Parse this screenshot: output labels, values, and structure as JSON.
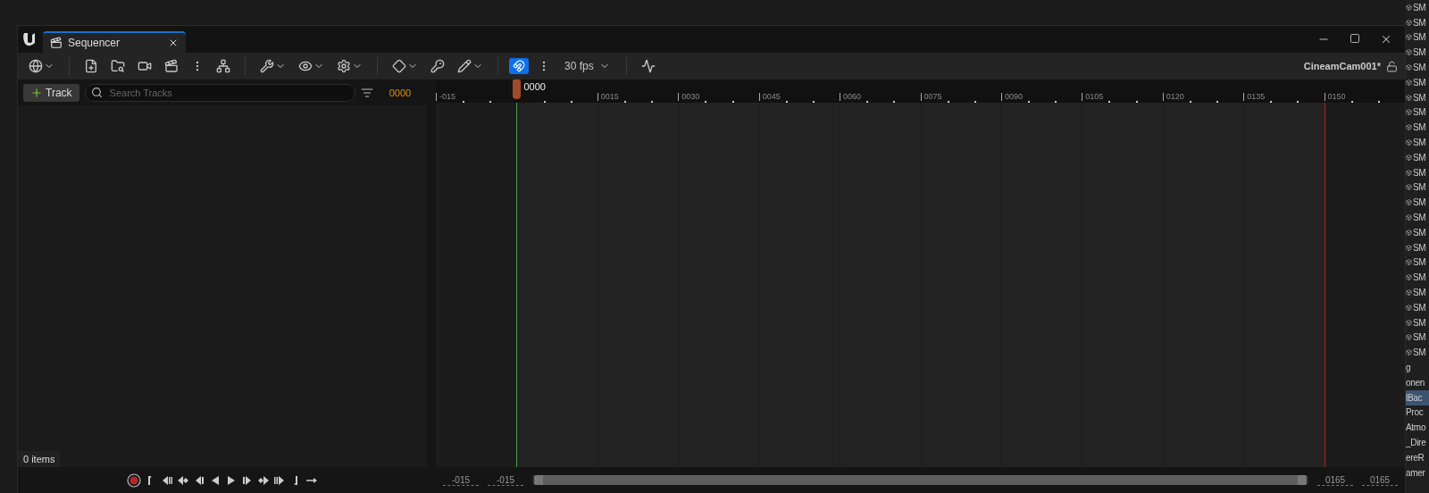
{
  "window": {
    "tab": {
      "label": "Sequencer",
      "selected": true
    }
  },
  "toolbar": {
    "snap": {
      "on": true
    },
    "frame_rate": "30 fps",
    "sequence_name": "CineamCam001*"
  },
  "tracks": {
    "add_button": "Track",
    "search": {
      "placeholder": "Search Tracks"
    },
    "current_frame": "0000",
    "status": "0 items"
  },
  "timeline": {
    "playhead": "0000",
    "ticks": [
      "-015",
      "0015",
      "0030",
      "0045",
      "0060",
      "0075",
      "0090",
      "0105",
      "0120",
      "0135",
      "0150"
    ]
  },
  "range": {
    "view_start": "-015",
    "work_start": "-015",
    "work_end": "0165",
    "view_end": "0165"
  },
  "outliner": {
    "items": [
      {
        "text": "SM",
        "kind": "mesh",
        "selected": false
      },
      {
        "text": "SM",
        "kind": "mesh",
        "selected": false
      },
      {
        "text": "SM",
        "kind": "mesh",
        "selected": false
      },
      {
        "text": "SM",
        "kind": "mesh",
        "selected": false
      },
      {
        "text": "SM",
        "kind": "mesh",
        "selected": false
      },
      {
        "text": "SM",
        "kind": "mesh",
        "selected": false
      },
      {
        "text": "SM",
        "kind": "mesh",
        "selected": false
      },
      {
        "text": "SM",
        "kind": "mesh",
        "selected": false
      },
      {
        "text": "SM",
        "kind": "mesh",
        "selected": false
      },
      {
        "text": "SM",
        "kind": "mesh",
        "selected": false
      },
      {
        "text": "SM",
        "kind": "mesh",
        "selected": false
      },
      {
        "text": "SM",
        "kind": "mesh",
        "selected": false
      },
      {
        "text": "SM",
        "kind": "mesh",
        "selected": false
      },
      {
        "text": "SM",
        "kind": "mesh",
        "selected": false
      },
      {
        "text": "SM",
        "kind": "mesh",
        "selected": false
      },
      {
        "text": "SM",
        "kind": "mesh",
        "selected": false
      },
      {
        "text": "SM",
        "kind": "mesh",
        "selected": false
      },
      {
        "text": "SM",
        "kind": "mesh",
        "selected": false
      },
      {
        "text": "SM",
        "kind": "mesh",
        "selected": false
      },
      {
        "text": "SM",
        "kind": "mesh",
        "selected": false
      },
      {
        "text": "SM",
        "kind": "mesh",
        "selected": false
      },
      {
        "text": "SM",
        "kind": "mesh",
        "selected": false
      },
      {
        "text": "SM",
        "kind": "mesh",
        "selected": false
      },
      {
        "text": "SM",
        "kind": "mesh",
        "selected": false
      },
      {
        "text": "g",
        "kind": "plain",
        "selected": false
      },
      {
        "text": "onen",
        "kind": "plain",
        "selected": false
      },
      {
        "text": "lBac",
        "kind": "plain",
        "selected": true
      },
      {
        "text": "Proc",
        "kind": "plain",
        "selected": false
      },
      {
        "text": "Atmo",
        "kind": "plain",
        "selected": false
      },
      {
        "text": "_Dire",
        "kind": "plain",
        "selected": false
      },
      {
        "text": "ereR",
        "kind": "plain",
        "selected": false
      },
      {
        "text": "amer",
        "kind": "plain",
        "selected": false
      }
    ]
  }
}
